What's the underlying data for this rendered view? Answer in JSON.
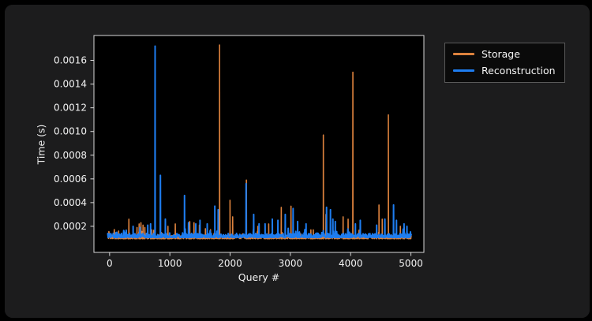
{
  "window": {
    "bg": "#000000",
    "panel_bg": "#1c1c1d"
  },
  "figure": {
    "bg": "#1c1c1d",
    "plot_bg": "#000000",
    "axis_color": "#d9d9d9",
    "text_color": "#f2f2f2",
    "xlabel": "Query #",
    "ylabel": "Time (s)"
  },
  "legend": {
    "bg": "#0a0a0a",
    "border": "#5a5a5a",
    "items": [
      {
        "label": "Storage",
        "color": "#dd823d"
      },
      {
        "label": "Reconstruction",
        "color": "#1e7df0"
      }
    ]
  },
  "chart_data": {
    "type": "line",
    "title": "",
    "xlabel": "Query #",
    "ylabel": "Time (s)",
    "xlim": [
      -260,
      5215
    ],
    "ylim": [
      -2e-05,
      0.00181
    ],
    "x_ticks": [
      0,
      1000,
      2000,
      3000,
      4000,
      5000
    ],
    "y_ticks": [
      0.0002,
      0.0004,
      0.0006,
      0.0008,
      0.001,
      0.0012,
      0.0014,
      0.0016
    ],
    "grid": false,
    "legend_position": "outside-upper-right",
    "x_range_of_data": [
      0,
      5000
    ],
    "series": [
      {
        "name": "Storage",
        "color": "#dd823d",
        "baseline_s": 9.5e-05,
        "noise_s": 3e-05,
        "spikes": [
          [
            150,
            0.00016
          ],
          [
            230,
            0.00014
          ],
          [
            320,
            0.00026
          ],
          [
            455,
            0.00019
          ],
          [
            490,
            0.00022
          ],
          [
            520,
            0.00023
          ],
          [
            555,
            0.00021
          ],
          [
            585,
            0.00019
          ],
          [
            700,
            0.00017
          ],
          [
            800,
            0.00013
          ],
          [
            830,
            0.00013
          ],
          [
            860,
            0.00012
          ],
          [
            968,
            0.0002
          ],
          [
            1090,
            0.00022
          ],
          [
            1330,
            0.00024
          ],
          [
            1400,
            0.00023
          ],
          [
            1490,
            0.00021
          ],
          [
            1590,
            0.00018
          ],
          [
            1825,
            0.00173
          ],
          [
            1998,
            0.00042
          ],
          [
            2042,
            0.00028
          ],
          [
            2270,
            0.00059
          ],
          [
            2460,
            0.0002
          ],
          [
            2640,
            0.00022
          ],
          [
            2849,
            0.00036
          ],
          [
            3010,
            0.00037
          ],
          [
            3340,
            0.00017
          ],
          [
            3380,
            0.00017
          ],
          [
            3547,
            0.00097
          ],
          [
            3590,
            0.0003
          ],
          [
            3875,
            0.00028
          ],
          [
            3958,
            0.00026
          ],
          [
            4037,
            0.0015
          ],
          [
            4470,
            0.00038
          ],
          [
            4524,
            0.00026
          ],
          [
            4626,
            0.00114
          ],
          [
            4825,
            0.0002
          ],
          [
            4890,
            0.00019
          ]
        ]
      },
      {
        "name": "Reconstruction",
        "color": "#1e7df0",
        "baseline_s": 0.000105,
        "noise_s": 3.5e-05,
        "spikes": [
          [
            120,
            0.00015
          ],
          [
            240,
            0.00016
          ],
          [
            390,
            0.0002
          ],
          [
            633,
            0.00021
          ],
          [
            680,
            0.00022
          ],
          [
            755,
            0.00172
          ],
          [
            843,
            0.00063
          ],
          [
            925,
            0.00026
          ],
          [
            1243,
            0.00046
          ],
          [
            1310,
            0.00023
          ],
          [
            1430,
            0.00022
          ],
          [
            1500,
            0.00025
          ],
          [
            1620,
            0.00022
          ],
          [
            1746,
            0.00037
          ],
          [
            1802,
            0.00034
          ],
          [
            2265,
            0.00056
          ],
          [
            2391,
            0.0003
          ],
          [
            2480,
            0.00022
          ],
          [
            2580,
            0.00022
          ],
          [
            2700,
            0.00026
          ],
          [
            2793,
            0.00025
          ],
          [
            2915,
            0.0003
          ],
          [
            3045,
            0.00035
          ],
          [
            3120,
            0.00024
          ],
          [
            3260,
            0.00022
          ],
          [
            3600,
            0.00036
          ],
          [
            3665,
            0.00034
          ],
          [
            3705,
            0.00026
          ],
          [
            3745,
            0.00024
          ],
          [
            4079,
            0.00022
          ],
          [
            4160,
            0.00025
          ],
          [
            4432,
            0.00021
          ],
          [
            4568,
            0.00026
          ],
          [
            4712,
            0.00038
          ],
          [
            4760,
            0.00025
          ],
          [
            4886,
            0.00022
          ],
          [
            4934,
            0.0002
          ]
        ]
      }
    ]
  }
}
